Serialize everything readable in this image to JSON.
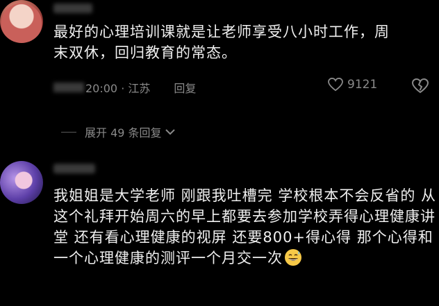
{
  "comments": [
    {
      "text": "最好的心理培训课就是让老师享受八小时工作，周末双休，回归教育的常态。",
      "time_location": "20:00 · 江苏",
      "reply_label": "回复",
      "likes": "9121"
    },
    {
      "text": "我姐姐是大学老师  刚跟我吐槽完  学校根本不会反省的  从这个礼拜开始周六的早上都要去参加学校弄得心理健康讲堂  还有看心理健康的视屏  还要800+得心得  那个心得和一个心理健康的测评一个月交一次"
    }
  ],
  "expand_replies_label": "展开 49 条回复",
  "icons": {
    "like": "heart-outline-icon",
    "dislike": "broken-heart-icon",
    "expand": "chevron-down-icon",
    "emoji": "sweat-smile-emoji-icon"
  }
}
